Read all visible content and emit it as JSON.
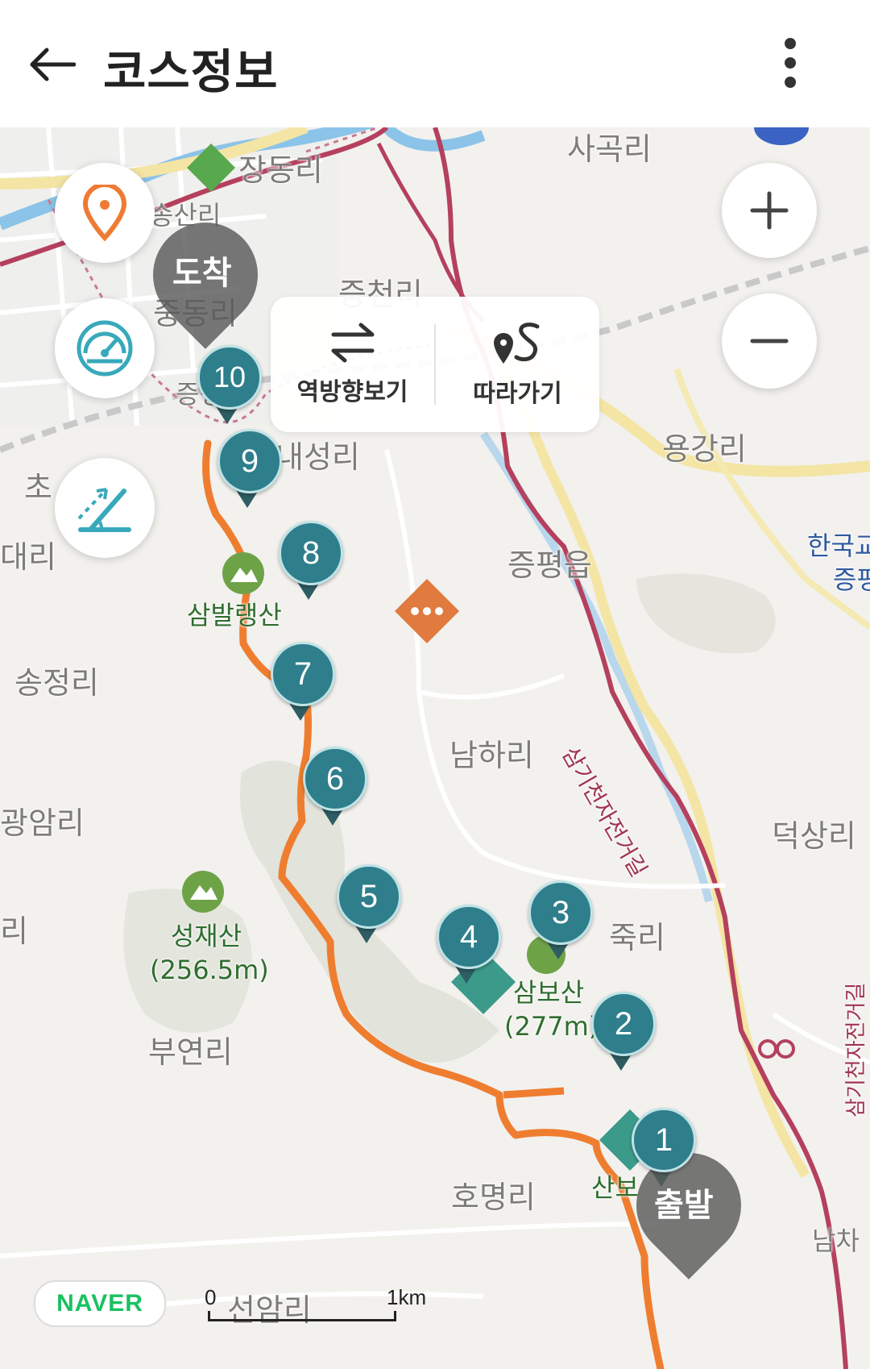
{
  "header": {
    "title": "코스정보"
  },
  "toolbar": {
    "reverse_label": "역방향보기",
    "follow_label": "따라가기"
  },
  "map_labels": {
    "sagok": "사곡리",
    "jangdong": "장동리",
    "songsan_dong": "송산리",
    "jungdong": "중동리",
    "jeungcheon": "증천리",
    "jeungpyeong": "증평",
    "naeseong": "내성리",
    "cho": "초",
    "daeri": "대리",
    "yonggang": "용강리",
    "hanguk": "한국교",
    "jeungp2": "증평",
    "jeungpyeong_eup": "증평읍",
    "songjeong": "송정리",
    "namha": "남하리",
    "gwangam": "광암리",
    "deoksang": "덕상리",
    "ri": "리",
    "juk": "죽리",
    "buyeon": "부연리",
    "homyeong": "호명리",
    "seonam": "선암리",
    "sambo_parking": "산보",
    "bike_path": "삼기천자전거길",
    "bike_path2": "삼기천자전거길",
    "namchi": "남차"
  },
  "peaks": {
    "sambal_name": "삼발랭산",
    "seongjae_name": "성재산",
    "seongjae_height": "(256.5m)",
    "sambo_name": "삼보산",
    "sambo_height": "(277m)"
  },
  "route": {
    "start_label": "출발",
    "end_label": "도착",
    "waypoints": [
      "1",
      "2",
      "3",
      "4",
      "5",
      "6",
      "7",
      "8",
      "9",
      "10"
    ]
  },
  "attribution": {
    "brand": "NAVER",
    "scale_start": "0",
    "scale_end": "1km"
  },
  "colors": {
    "route": "#ef7d2f",
    "marker": "#2e7e8c",
    "road_red": "#b5405e",
    "road_yellow": "#f4e5a4",
    "forest": "#dedfd6"
  },
  "icons": {
    "back": "arrow-left-icon",
    "more": "more-vertical-icon",
    "location": "location-pin-icon",
    "speed": "speedometer-icon",
    "slope": "slope-angle-icon",
    "reverse": "swap-arrows-icon",
    "follow": "follow-route-icon",
    "zoom_in": "plus-icon",
    "zoom_out": "minus-icon"
  }
}
